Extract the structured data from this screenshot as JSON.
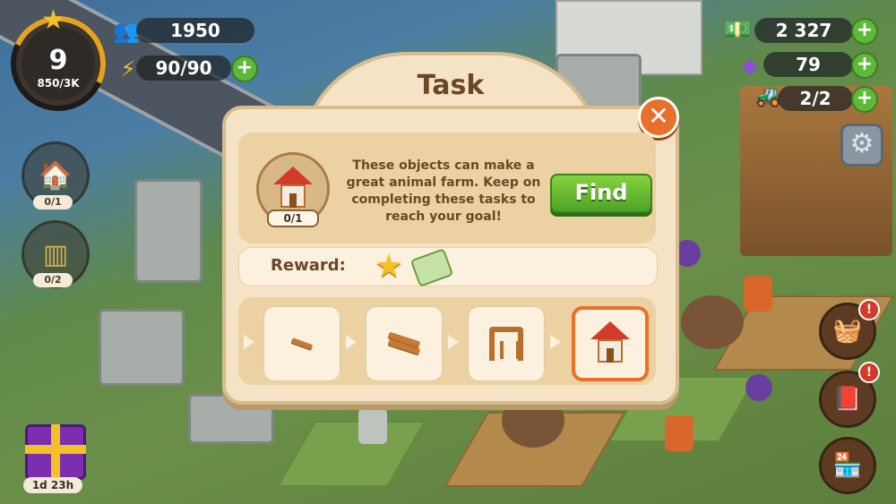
{
  "hud": {
    "level": "9",
    "xp": "850/3K",
    "population": "1950",
    "energy": "90/90",
    "cash": "2 327",
    "gems": "79",
    "vehicles": "2/2"
  },
  "side_tasks": [
    {
      "icon": "farm-house-icon",
      "count": "0/1"
    },
    {
      "icon": "fence-icon",
      "count": "0/2"
    }
  ],
  "gift": {
    "timer": "1d 23h"
  },
  "dialog": {
    "title": "Task",
    "task_count": "0/1",
    "description": "These objects can make a great animal farm. Keep on completing these tasks to reach your goal!",
    "find_label": "Find",
    "reward_label": "Reward:",
    "chain": [
      "wood-plank-icon",
      "wood-planks-icon",
      "wooden-frame-icon",
      "farm-house-icon"
    ]
  },
  "colors": {
    "accent_orange": "#e9702a",
    "find_green": "#5fb83a",
    "dialog_bg": "#f4e3c4",
    "text_brown": "#6b4727"
  }
}
